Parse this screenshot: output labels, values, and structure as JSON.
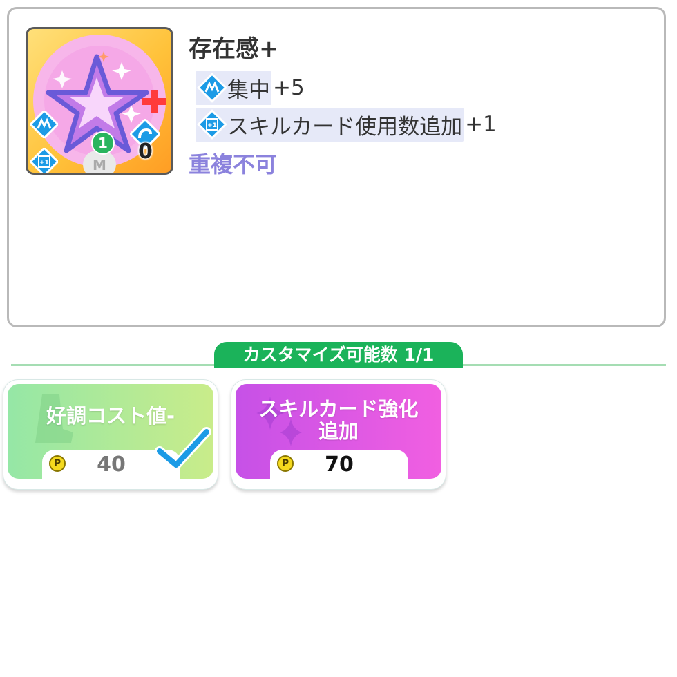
{
  "card": {
    "title": "存在感+",
    "level": "1",
    "cost": "0",
    "effects": [
      {
        "icon": "concentration-icon",
        "label": "集中",
        "value": "+5"
      },
      {
        "icon": "card-plus-icon",
        "label": "スキルカード使用数追加",
        "value": "+1"
      }
    ],
    "note": "重複不可"
  },
  "customize": {
    "label": "カスタマイズ可能数 1/1",
    "options": [
      {
        "label": "好調コスト値-",
        "price": "40",
        "selected": true,
        "color": "#b3e894"
      },
      {
        "label": "スキルカード強化\n追加",
        "price": "70",
        "selected": false,
        "color": "#d95ae5"
      }
    ]
  },
  "colors": {
    "accent_green": "#1bb35a",
    "note_purple": "#8b82dd",
    "coin_yellow": "#f4d91e",
    "check_blue": "#1c9be6"
  }
}
